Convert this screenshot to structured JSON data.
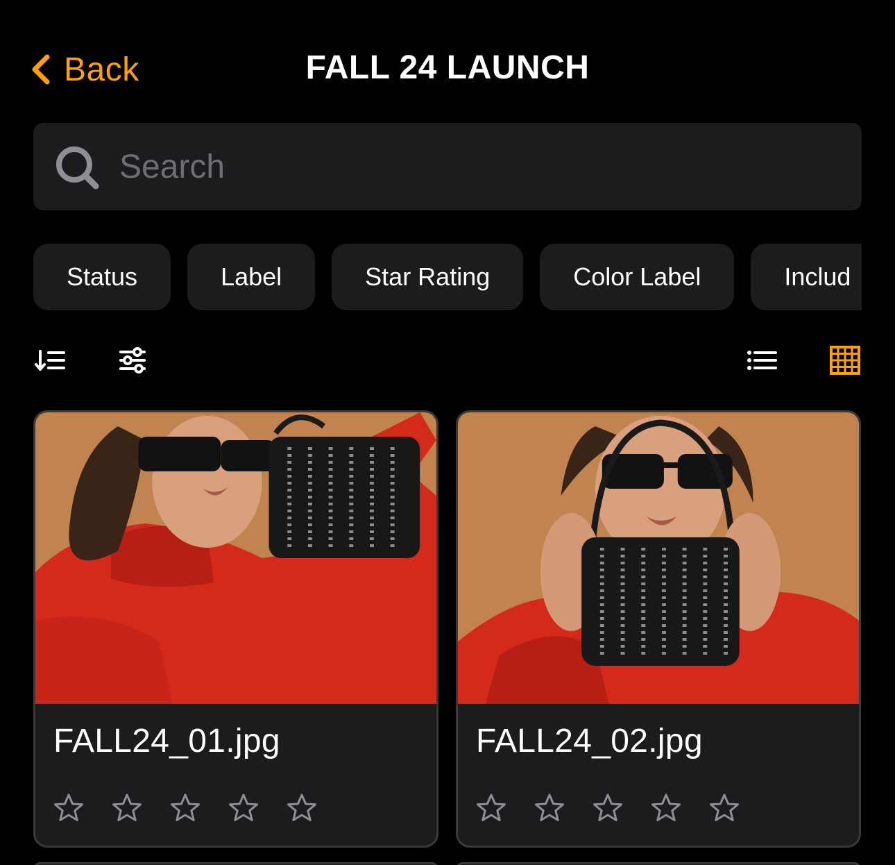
{
  "header": {
    "back_label": "Back",
    "title": "FALL 24 LAUNCH"
  },
  "search": {
    "placeholder": "Search",
    "value": ""
  },
  "filters": [
    {
      "label": "Status"
    },
    {
      "label": "Label"
    },
    {
      "label": "Star Rating"
    },
    {
      "label": "Color Label"
    },
    {
      "label": "Includ"
    }
  ],
  "toolbar": {
    "sort_icon": "sort-descending-icon",
    "adjust_icon": "sliders-icon",
    "list_view_icon": "list-view-icon",
    "grid_view_icon": "grid-view-icon",
    "active_view": "grid"
  },
  "assets": [
    {
      "filename": "FALL24_01.jpg",
      "rating": 0,
      "max_rating": 5
    },
    {
      "filename": "FALL24_02.jpg",
      "rating": 0,
      "max_rating": 5
    }
  ],
  "colors": {
    "accent": "#FF9F0A",
    "background": "#000000",
    "surface": "#1C1C1E",
    "border": "#3A3A3C",
    "muted_text": "#6E6E73"
  }
}
